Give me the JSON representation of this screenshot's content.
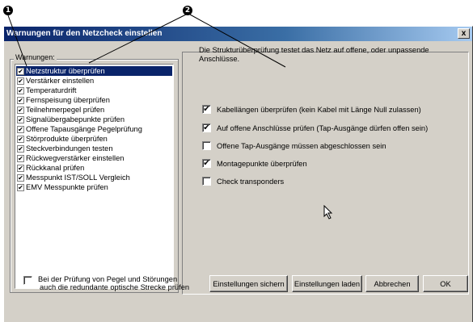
{
  "callouts": [
    "1",
    "2"
  ],
  "window": {
    "title": "Warnungen für den Netzcheck einstellen",
    "close_label": "x"
  },
  "warnings": {
    "group_label": "Warnungen:",
    "items": [
      {
        "label": "Netzstruktur überprüfen",
        "checked": true,
        "selected": true
      },
      {
        "label": "Verstärker einstellen",
        "checked": true
      },
      {
        "label": "Temperaturdrift",
        "checked": true
      },
      {
        "label": "Fernspeisung überprüfen",
        "checked": true
      },
      {
        "label": "Teilnehmerpegel prüfen",
        "checked": true
      },
      {
        "label": "Signalübergabepunkte prüfen",
        "checked": true
      },
      {
        "label": "Offene Tapausgänge Pegelprüfung",
        "checked": true
      },
      {
        "label": "Störprodukte überprüfen",
        "checked": true
      },
      {
        "label": "Steckverbindungen testen",
        "checked": true
      },
      {
        "label": "Rückwegverstärker einstellen",
        "checked": true
      },
      {
        "label": "Rückkanal prüfen",
        "checked": true
      },
      {
        "label": "Messpunkt IST/SOLL Vergleich",
        "checked": true
      },
      {
        "label": "EMV Messpunkte prüfen",
        "checked": true
      }
    ]
  },
  "details": {
    "description": "Die Strukturüberprüfung testet das Netz auf offene, oder unpassende Anschlüsse.",
    "options": [
      {
        "label": "Kabellängen überprüfen (kein Kabel mit Länge Null zulassen)",
        "checked": true
      },
      {
        "label": "Auf offene Anschlüsse prüfen (Tap-Ausgänge dürfen offen sein)",
        "checked": true
      },
      {
        "label": "Offene Tap-Ausgänge müssen abgeschlossen sein",
        "checked": false
      },
      {
        "label": "Montagepunkte überprüfen",
        "checked": true
      },
      {
        "label": "Check transponders",
        "checked": false
      }
    ]
  },
  "footer": {
    "redundant_check": {
      "line1": "Bei der Prüfung von Pegel und Störungen",
      "line2": "auch die redundante optische Strecke prüfen",
      "checked": false
    },
    "buttons": {
      "save": "Einstellungen sichern",
      "load": "Einstellungen laden",
      "cancel": "Abbrechen",
      "ok": "OK"
    }
  }
}
